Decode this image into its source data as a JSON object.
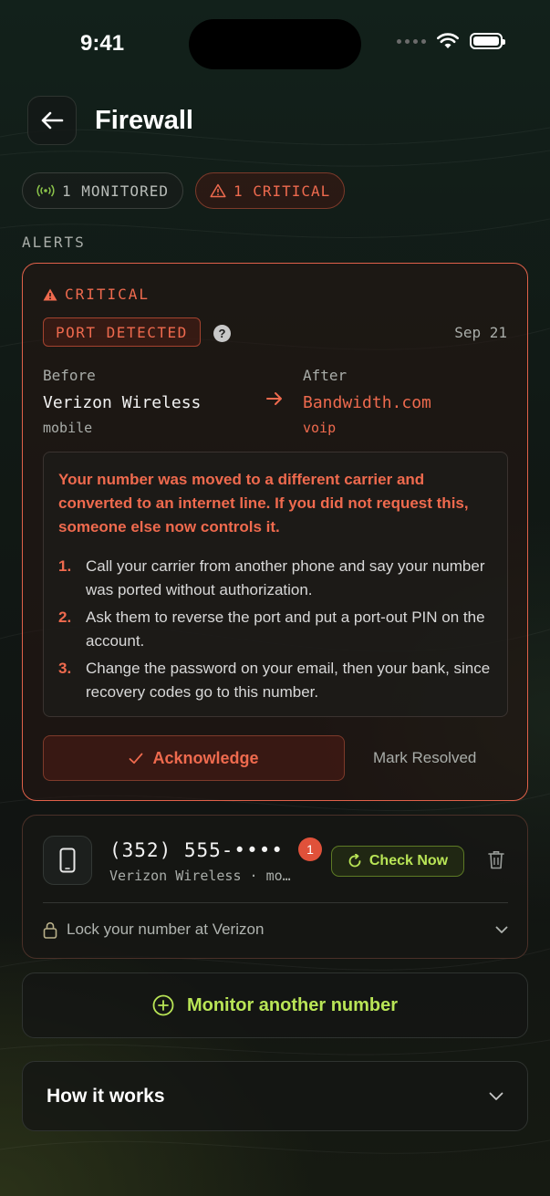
{
  "status_bar": {
    "time": "9:41"
  },
  "header": {
    "title": "Firewall"
  },
  "chips": {
    "monitored": "1 MONITORED",
    "critical": "1 CRITICAL"
  },
  "section": {
    "alerts_label": "ALERTS"
  },
  "alert": {
    "severity": "CRITICAL",
    "badge": "PORT DETECTED",
    "help": "?",
    "date": "Sep 21",
    "before": {
      "label": "Before",
      "carrier": "Verizon Wireless",
      "type": "mobile"
    },
    "after": {
      "label": "After",
      "carrier": "Bandwidth.com",
      "type": "voip"
    },
    "warning": "Your number was moved to a different carrier and converted to an internet line. If you did not request this, someone else now controls it.",
    "steps": [
      {
        "num": "1.",
        "text": "Call your carrier from another phone and say your number was ported without authorization."
      },
      {
        "num": "2.",
        "text": "Ask them to reverse the port and put a port-out PIN on the account."
      },
      {
        "num": "3.",
        "text": "Change the password on your email, then your bank, since recovery codes go to this number."
      }
    ],
    "acknowledge_label": "Acknowledge",
    "resolve_label": "Mark Resolved"
  },
  "number": {
    "value": "(352) 555-••••",
    "badge_count": "1",
    "carrier": "Verizon Wireless · mo…",
    "check_label": "Check Now",
    "lock_label": "Lock your number at Verizon"
  },
  "monitor_label": "Monitor another number",
  "how_it_works_label": "How it works",
  "colors": {
    "critical": "#ee6a4e",
    "accent_green": "#b9e556",
    "badge_red": "#e0513a"
  },
  "icons": [
    "wifi-icon",
    "battery-icon",
    "back-arrow-icon",
    "signal-icon",
    "warning-icon",
    "help-icon",
    "arrow-right-icon",
    "check-icon",
    "phone-icon",
    "refresh-icon",
    "trash-icon",
    "lock-icon",
    "chevron-down-icon",
    "plus-circle-icon"
  ]
}
